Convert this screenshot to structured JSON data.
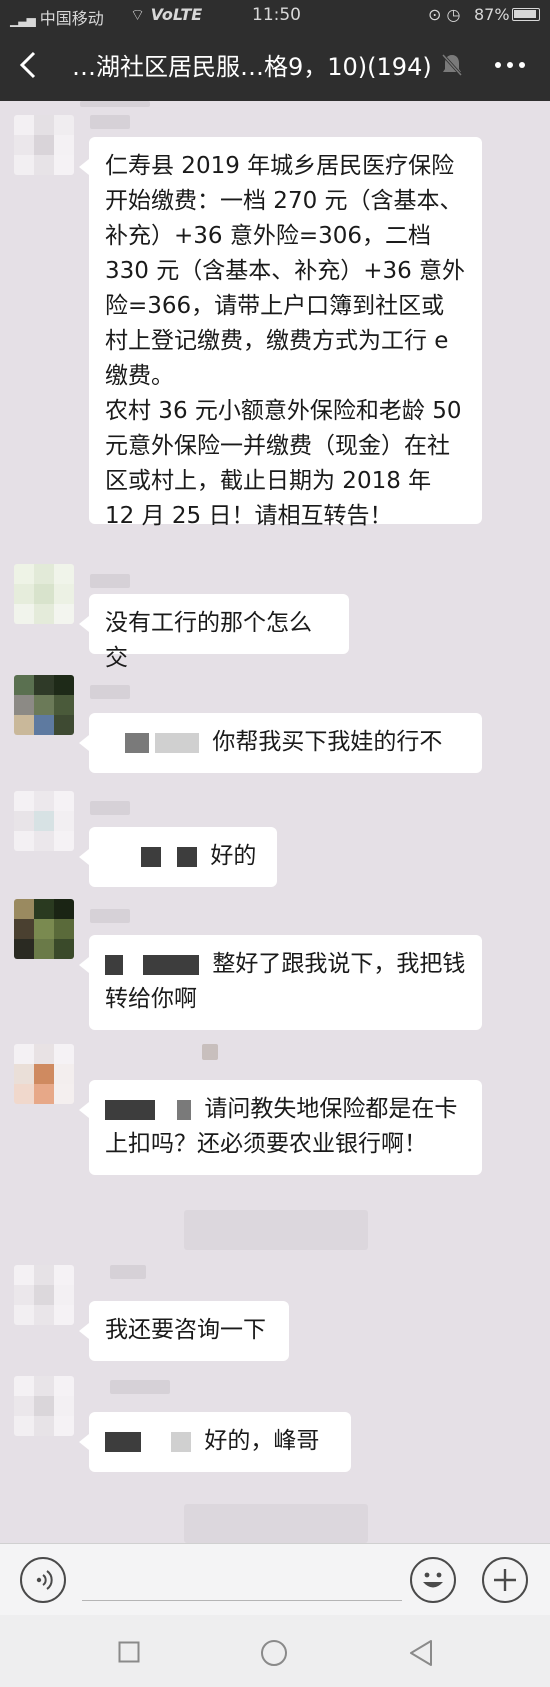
{
  "status_bar": {
    "carrier": "中国移动",
    "network": "VoLTE",
    "time": "11:50",
    "battery": "87%"
  },
  "title_bar": {
    "title": "…湖社区居民服…格9，10)(194)",
    "muted": true
  },
  "messages": [
    {
      "sender": "redacted",
      "paragraphs": [
        "仁寿县 2019 年城乡居民医疗保险开始缴费：一档 270 元（含基本、补充）+36 意外险=306，二档 330 元（含基本、补充）+36 意外险=366，请带上户口簿到社区或村上登记缴费，缴费方式为工行 e 缴费。",
        "农村 36 元小额意外保险和老龄 50 元意外保险一并缴费（现金）在社区或村上，截止日期为 2018 年 12 月 25 日！请相互转告！"
      ]
    },
    {
      "sender": "redacted",
      "text": "没有工行的那个怎么交"
    },
    {
      "sender": "redacted",
      "text": "你帮我买下我娃的行不"
    },
    {
      "sender": "redacted",
      "text": "好的"
    },
    {
      "sender": "redacted",
      "text": "整好了跟我说下，我把钱转给你啊"
    },
    {
      "sender": "redacted",
      "text": "请问教失地保险都是在卡上扣吗？还必须要农业银行啊！"
    },
    {
      "sender": "redacted",
      "text": "我还要咨询一下"
    },
    {
      "sender": "redacted",
      "text": "好的，峰哥"
    }
  ],
  "input_bar": {
    "voice_icon": "voice-icon",
    "emoji_icon": "emoji-icon",
    "plus_icon": "plus-icon"
  },
  "nav_bar": {
    "recent_icon": "square-icon",
    "home_icon": "circle-icon",
    "back_icon": "triangle-back-icon"
  }
}
